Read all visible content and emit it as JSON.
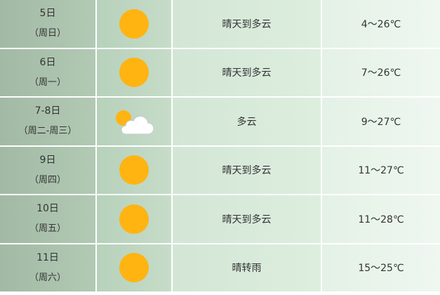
{
  "rows": [
    {
      "date": "5日",
      "week": "（周日）",
      "icon": "sun-icon",
      "desc": "晴天到多云",
      "temp": "4～26℃"
    },
    {
      "date": "6日",
      "week": "（周一）",
      "icon": "sun-icon",
      "desc": "晴天到多云",
      "temp": "7～26℃"
    },
    {
      "date": "7-8日",
      "week": "（周二-周三）",
      "icon": "partly-cloudy-icon",
      "desc": "多云",
      "temp": "9～27℃"
    },
    {
      "date": "9日",
      "week": "（周四）",
      "icon": "sun-icon",
      "desc": "晴天到多云",
      "temp": "11～27℃"
    },
    {
      "date": "10日",
      "week": "（周五）",
      "icon": "sun-icon",
      "desc": "晴天到多云",
      "temp": "11～28℃"
    },
    {
      "date": "11日",
      "week": "（周六）",
      "icon": "sun-icon",
      "desc": "晴转雨",
      "temp": "15～25℃"
    }
  ],
  "colors": {
    "sun": "#ffb412",
    "date_bg": "#a2baa5",
    "icon_bg": "#b7d1bb",
    "desc_bg": "#d3e6d5",
    "temp_bg": "#e4f1e6"
  }
}
